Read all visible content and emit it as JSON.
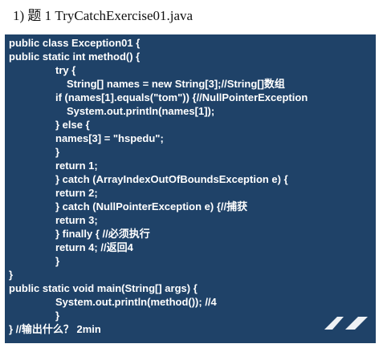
{
  "heading": {
    "number": "1)",
    "text": "题 1 TryCatchExercise01.java"
  },
  "code_lines": [
    "public class Exception01 {",
    "public static int method() {",
    "try {",
    "String[] names = new String[3];//String[]数组",
    "if (names[1].equals(\"tom\")) {//NullPointerException",
    "System.out.println(names[1]);",
    "} else {",
    "names[3] = \"hspedu\";",
    "}",
    "return 1;",
    "} catch (ArrayIndexOutOfBoundsException e) {",
    "return 2;",
    "} catch (NullPointerException e) {//捕获",
    "return 3;",
    "} finally { //必须执行",
    "return 4; //返回4",
    "}",
    "}",
    "public static void main(String[] args) {",
    "System.out.println(method()); //4",
    "}",
    "} //输出什么？ 2min"
  ],
  "colors": {
    "code_background": "#1f4268",
    "code_text": "#ffffff"
  }
}
